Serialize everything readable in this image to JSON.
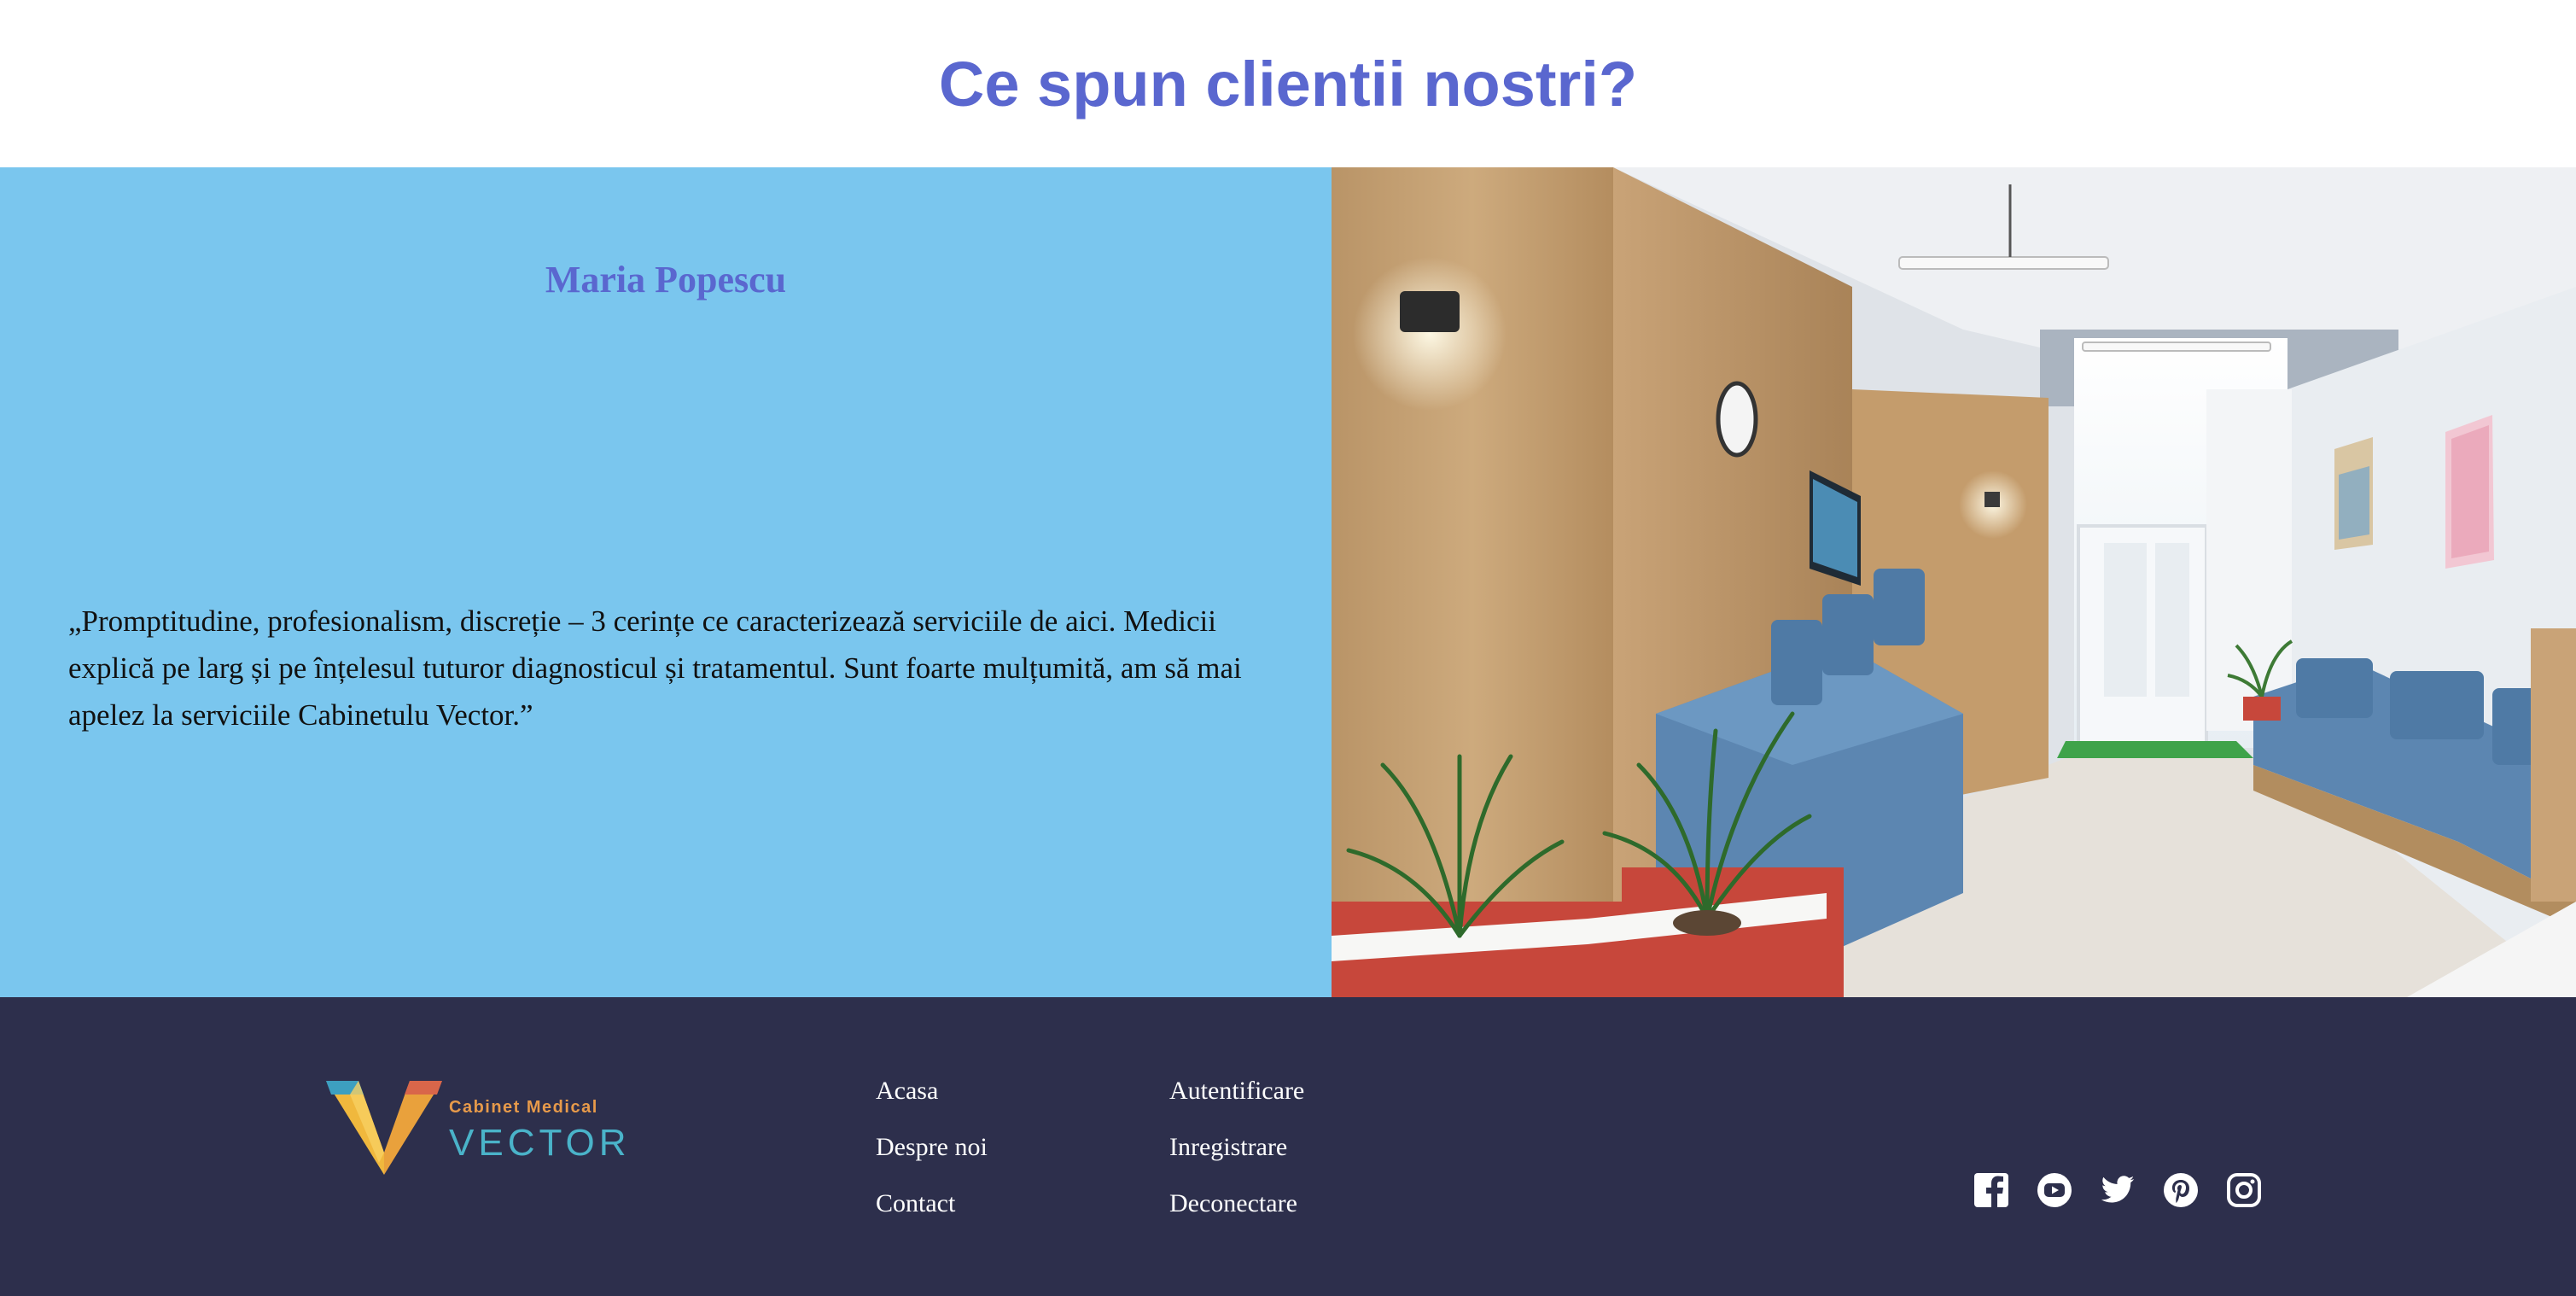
{
  "page": {
    "title": "Ce spun clientii nostri?"
  },
  "testimonial": {
    "author": "Maria Popescu",
    "quote": "„Promptitudine, profesionalism, discreție – 3 cerințe ce caracterizează serviciile de aici. Medicii explică pe larg și pe înțelesul tuturor diagnosticul și tratamentul. Sunt foarte mulțumită, am să mai apelez la serviciile Cabinetulu Vector.”"
  },
  "footer": {
    "logo": {
      "subtitle": "Cabinet Medical",
      "name": "VECTOR"
    },
    "nav_col1": [
      "Acasa",
      "Despre noi",
      "Contact"
    ],
    "nav_col2": [
      "Autentificare",
      "Inregistrare",
      "Deconectare"
    ],
    "social_icons": [
      "facebook-icon",
      "youtube-icon",
      "twitter-icon",
      "pinterest-icon",
      "instagram-icon"
    ]
  },
  "colors": {
    "accent": "#5a67cf",
    "testimonial_bg": "#7ac6ee",
    "footer_bg": "#2d2f4c"
  }
}
